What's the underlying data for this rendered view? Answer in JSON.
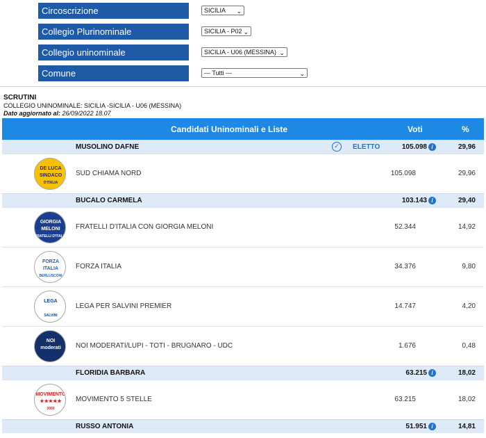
{
  "filters": [
    {
      "label": "Circoscrizione",
      "value": "SICILIA"
    },
    {
      "label": "Collegio Plurinominale",
      "value": "SICILIA - P02"
    },
    {
      "label": "Collegio uninominale",
      "value": "SICILIA - U06 (MESSINA)"
    },
    {
      "label": "Comune",
      "value": "--- Tutti ---"
    }
  ],
  "header": {
    "scrutini": "SCRUTINI",
    "collegio": "COLLEGIO UNINOMINALE: SICILIA -SICILIA - U06 (MESSINA)",
    "aggiornato_label": "Dato aggiornato al:",
    "aggiornato_value": "26/09/2022 18.07"
  },
  "table": {
    "col_candidati": "Candidati Uninominali e Liste",
    "col_voti": "Voti",
    "col_pct": "%"
  },
  "candidates": [
    {
      "name": "MUSOLINO DAFNE",
      "status": "ELETTO",
      "votes": "105.098",
      "pct": "29,96",
      "lists": [
        {
          "name": "SUD CHIAMA NORD",
          "votes": "105.098",
          "pct": "29,96",
          "logo_text": [
            "DE LUCA",
            "SINDACO",
            "D'ITALIA"
          ],
          "logo_bg": "#f6c200",
          "logo_fg": "#1a237e"
        }
      ]
    },
    {
      "name": "BUCALO CARMELA",
      "status": "",
      "votes": "103.143",
      "pct": "29,40",
      "lists": [
        {
          "name": "FRATELLI D'ITALIA CON GIORGIA MELONI",
          "votes": "52.344",
          "pct": "14,92",
          "logo_text": [
            "GIORGIA",
            "MELONI",
            "FRATELLI D'ITALIA"
          ],
          "logo_bg": "#1b3f8f",
          "logo_fg": "#ffffff"
        },
        {
          "name": "FORZA ITALIA",
          "votes": "34.376",
          "pct": "9,80",
          "logo_text": [
            "FORZA",
            "ITALIA",
            "BERLUSCONI"
          ],
          "logo_bg": "#ffffff",
          "logo_fg": "#1565c0"
        },
        {
          "name": "LEGA PER SALVINI PREMIER",
          "votes": "14.747",
          "pct": "4,20",
          "logo_text": [
            "LEGA",
            "",
            "SALVINI"
          ],
          "logo_bg": "#ffffff",
          "logo_fg": "#0d47a1"
        },
        {
          "name": "NOI MODERATI/LUPI - TOTI - BRUGNARO - UDC",
          "votes": "1.676",
          "pct": "0,48",
          "logo_text": [
            "NOI",
            "moderati",
            ""
          ],
          "logo_bg": "#14306b",
          "logo_fg": "#ffffff"
        }
      ]
    },
    {
      "name": "FLORIDIA BARBARA",
      "status": "",
      "votes": "63.215",
      "pct": "18,02",
      "lists": [
        {
          "name": "MOVIMENTO 5 STELLE",
          "votes": "63.215",
          "pct": "18,02",
          "logo_text": [
            "MOVIMENTO",
            "★★★★★",
            "2050"
          ],
          "logo_bg": "#ffffff",
          "logo_fg": "#c62828"
        }
      ]
    },
    {
      "name": "RUSSO ANTONIA",
      "status": "",
      "votes": "51.951",
      "pct": "14,81",
      "lists": []
    }
  ]
}
